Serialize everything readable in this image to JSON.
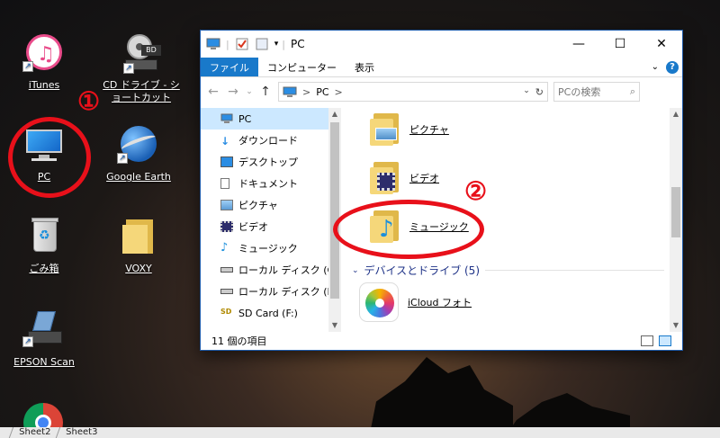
{
  "desktop": {
    "icons": [
      {
        "label": "iTunes"
      },
      {
        "label": "CD ドライブ - ショートカット"
      },
      {
        "label": "PC"
      },
      {
        "label": "Google Earth"
      },
      {
        "label": "ごみ箱"
      },
      {
        "label": "VOXY"
      },
      {
        "label": "EPSON Scan"
      }
    ],
    "markers": {
      "one": "①",
      "two": "②"
    }
  },
  "explorer": {
    "title": "PC",
    "ribbon_tabs": [
      "ファイル",
      "コンピューター",
      "表示"
    ],
    "address_path": "PC",
    "search_placeholder": "PCの検索",
    "nav_items": [
      "PC",
      "ダウンロード",
      "デスクトップ",
      "ドキュメント",
      "ピクチャ",
      "ビデオ",
      "ミュージック",
      "ローカル ディスク (C",
      "ローカル ディスク (D",
      "SD Card (F:)"
    ],
    "folders": [
      "ピクチャ",
      "ビデオ",
      "ミュージック"
    ],
    "group_header": "デバイスとドライブ (5)",
    "devices": [
      "iCloud フォト"
    ],
    "status": "11 個の項目"
  },
  "taskbar": {
    "sheets": [
      "Sheet2",
      "Sheet3"
    ]
  },
  "colors": {
    "accent": "#1979ca",
    "marker": "#e8101a"
  }
}
